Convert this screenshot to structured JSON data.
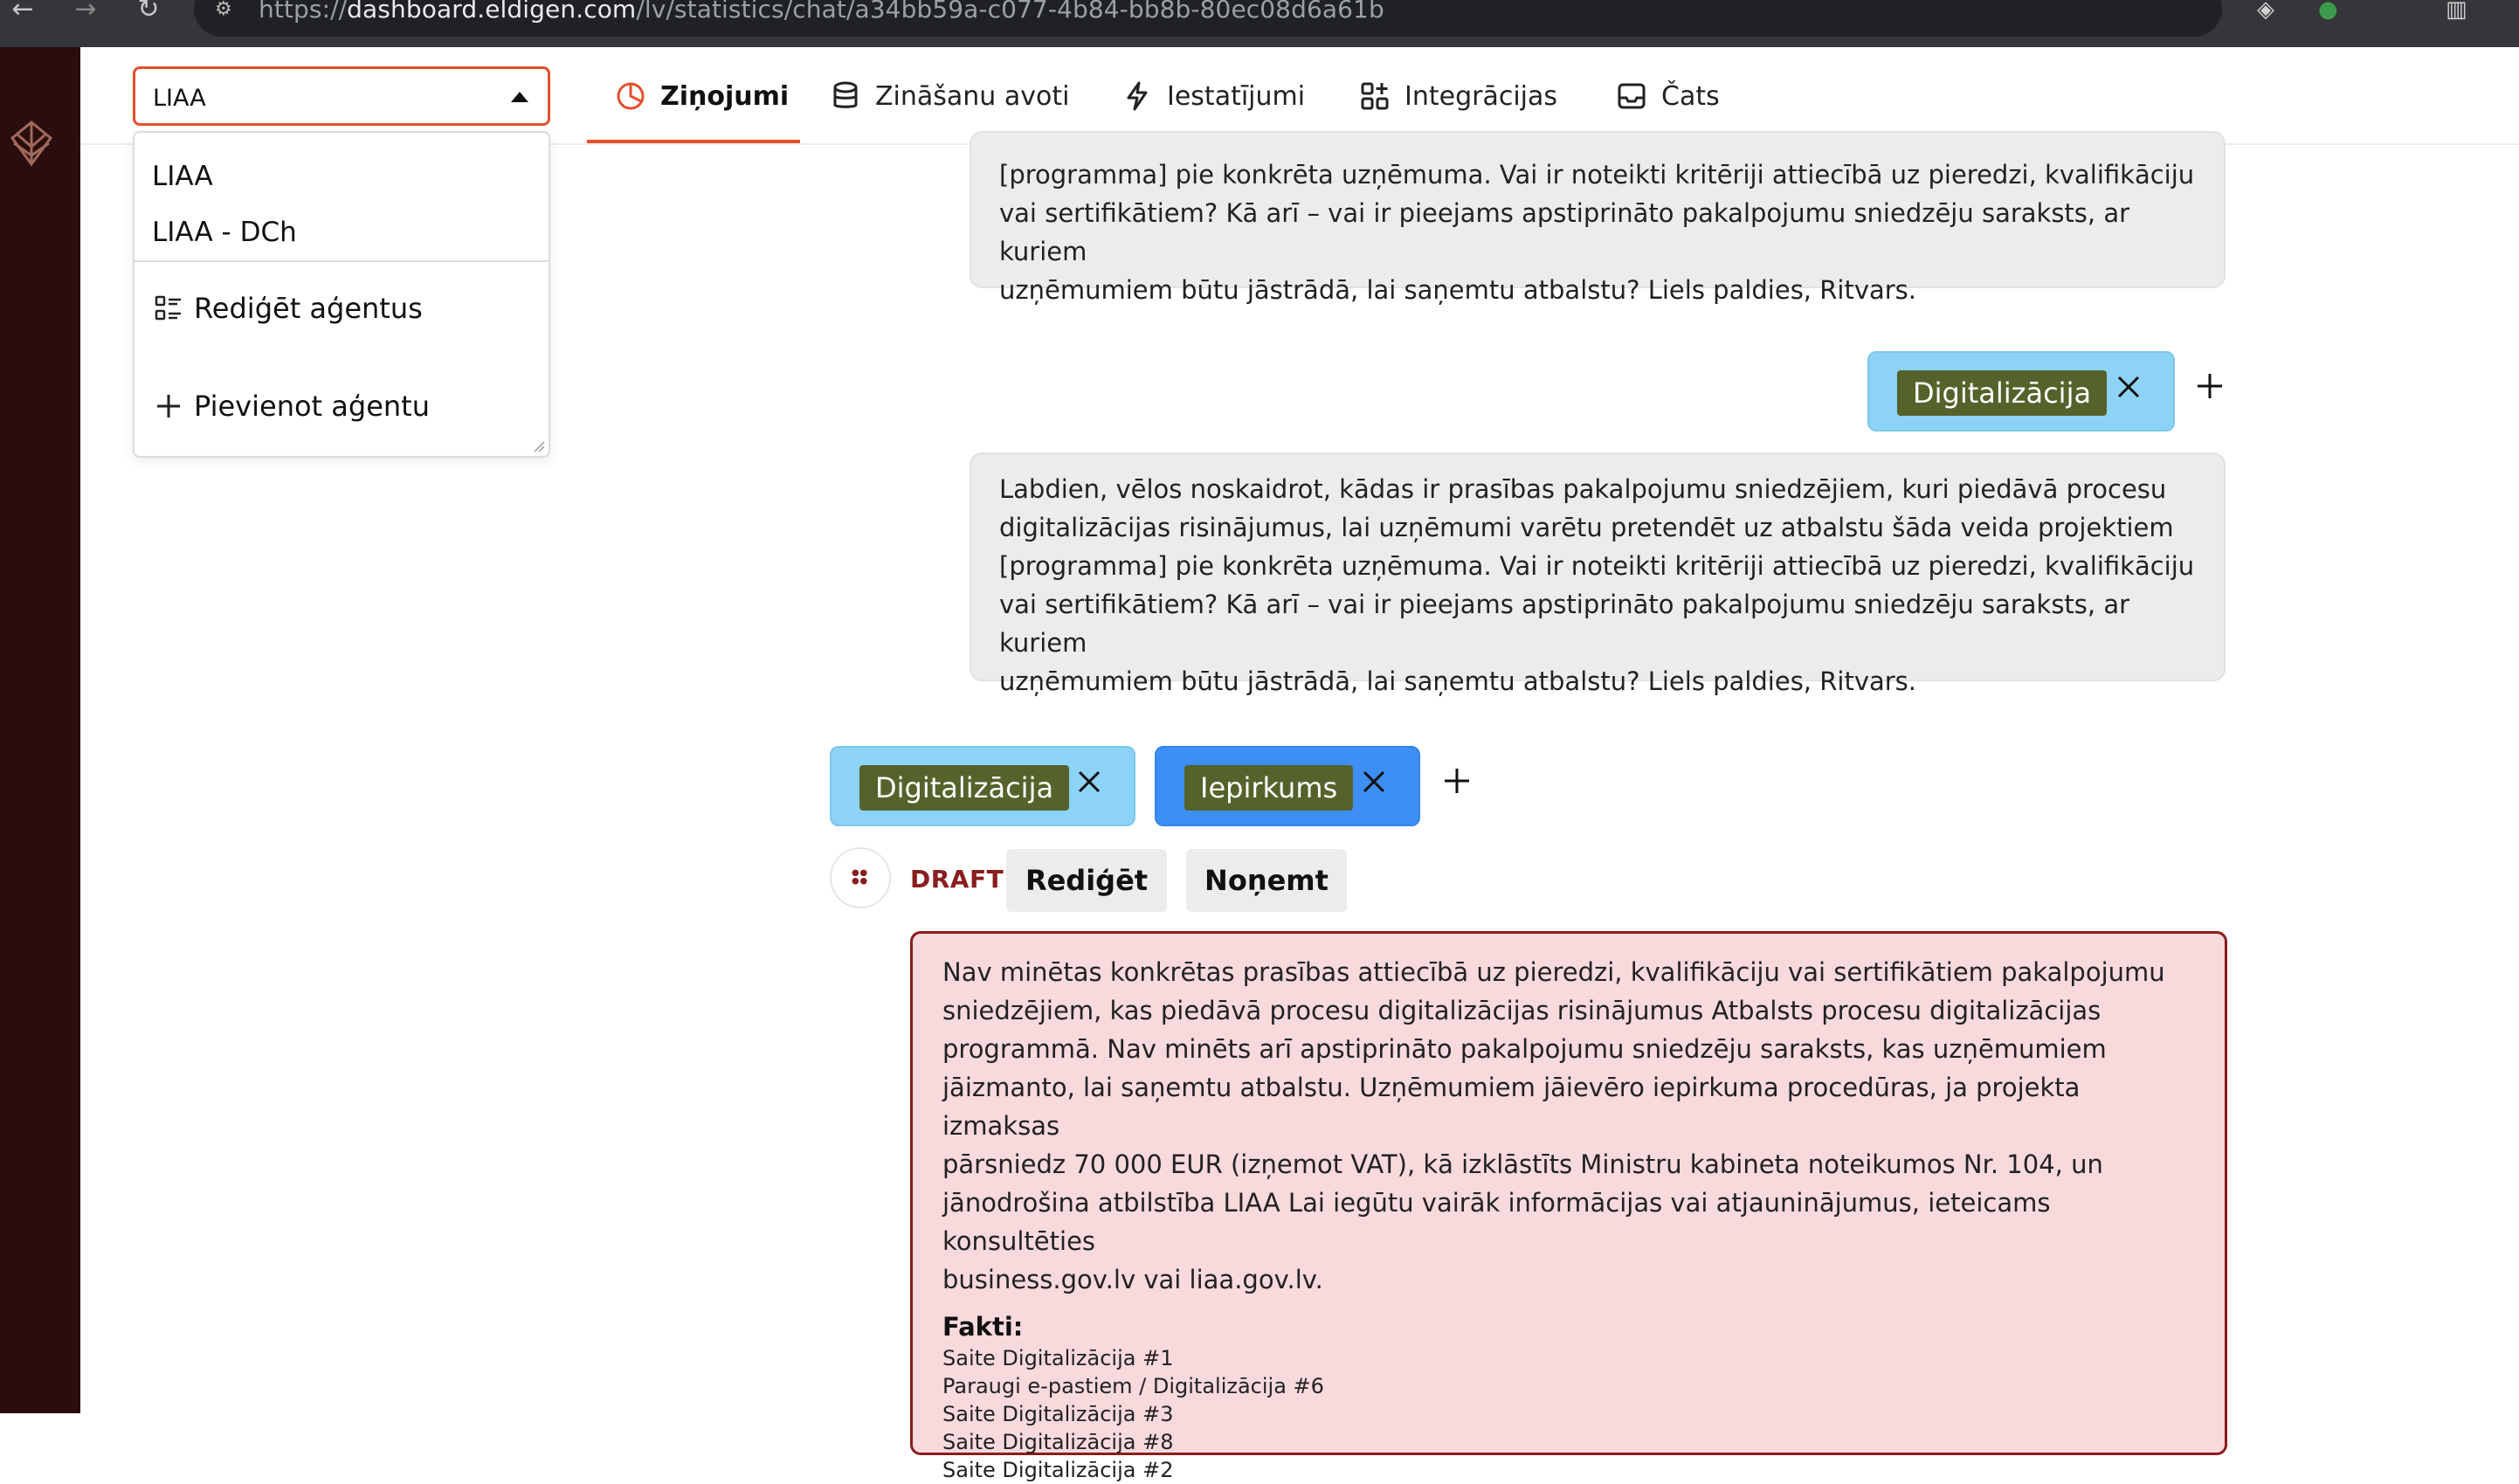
{
  "browser": {
    "url_prefix": "https://",
    "url_domain": "dashboard.eldigen.com",
    "url_path": "/lv/statistics/chat/a34bb59a-c077-4b84-bb8b-80ec08d6a61b"
  },
  "header": {
    "agent_selected": "LIAA",
    "tabs": [
      {
        "label": "Ziņojumi",
        "icon": "pie-chart-icon",
        "active": true
      },
      {
        "label": "Zināšanu avoti",
        "icon": "database-icon",
        "active": false
      },
      {
        "label": "Iestatījumi",
        "icon": "bolt-icon",
        "active": false
      },
      {
        "label": "Integrācijas",
        "icon": "apps-plus-icon",
        "active": false
      },
      {
        "label": "Čats",
        "icon": "inbox-icon",
        "active": false
      }
    ]
  },
  "dropdown": {
    "options": [
      "LIAA",
      "LIAA - DCh"
    ],
    "edit_label": "Rediģēt aģentus",
    "add_label": "Pievienot aģentu"
  },
  "messages": {
    "top_bubble_lines": [
      "[programma] pie konkrēta uzņēmuma. Vai ir noteikti kritēriji attiecībā uz pieredzi, kvalifikāciju",
      "vai sertifikātiem? Kā arī – vai ir pieejams apstiprināto pakalpojumu sniedzēju saraksts, ar kuriem",
      "uzņēmumiem būtu jāstrādā, lai saņemtu atbalstu? Liels paldies, Ritvars."
    ],
    "user_tag": "Digitalizācija",
    "user_bubble_lines": [
      "Labdien, vēlos noskaidrot, kādas ir prasības pakalpojumu sniedzējiem, kuri piedāvā procesu",
      "digitalizācijas risinājumus, lai uzņēmumi varētu pretendēt uz atbalstu šāda veida projektiem",
      "[programma] pie konkrēta uzņēmuma. Vai ir noteikti kritēriji attiecībā uz pieredzi, kvalifikāciju",
      "vai sertifikātiem? Kā arī – vai ir pieejams apstiprināto pakalpojumu sniedzēju saraksts, ar kuriem",
      "uzņēmumiem būtu jāstrādā, lai saņemtu atbalstu? Liels paldies, Ritvars."
    ],
    "answer_tags": [
      "Digitalizācija",
      "Iepirkums"
    ]
  },
  "draft": {
    "status": "DRAFT",
    "edit_label": "Rediģēt",
    "remove_label": "Noņemt",
    "answer_lines": [
      "Nav minētas konkrētas prasības attiecībā uz pieredzi, kvalifikāciju vai sertifikātiem pakalpojumu",
      "sniedzējiem, kas piedāvā procesu digitalizācijas risinājumus Atbalsts procesu digitalizācijas",
      "programmā. Nav minēts arī apstiprināto pakalpojumu sniedzēju saraksts, kas uzņēmumiem",
      "jāizmanto, lai saņemtu atbalstu. Uzņēmumiem jāievēro iepirkuma procedūras, ja projekta izmaksas",
      "pārsniedz 70 000 EUR (izņemot VAT), kā izklāstīts Ministru kabineta noteikumos Nr. 104, un",
      "jānodrošina atbilstība LIAA Lai iegūtu vairāk informācijas vai atjauninājumus, ieteicams konsultēties",
      "business.gov.lv vai liaa.gov.lv."
    ],
    "facts_title": "Fakti:",
    "facts": [
      "Saite Digitalizācija #1",
      "Paraugi e-pastiem / Digitalizācija #6",
      "Saite Digitalizācija #3",
      "Saite Digitalizācija #8",
      "Saite Digitalizācija #2"
    ]
  }
}
